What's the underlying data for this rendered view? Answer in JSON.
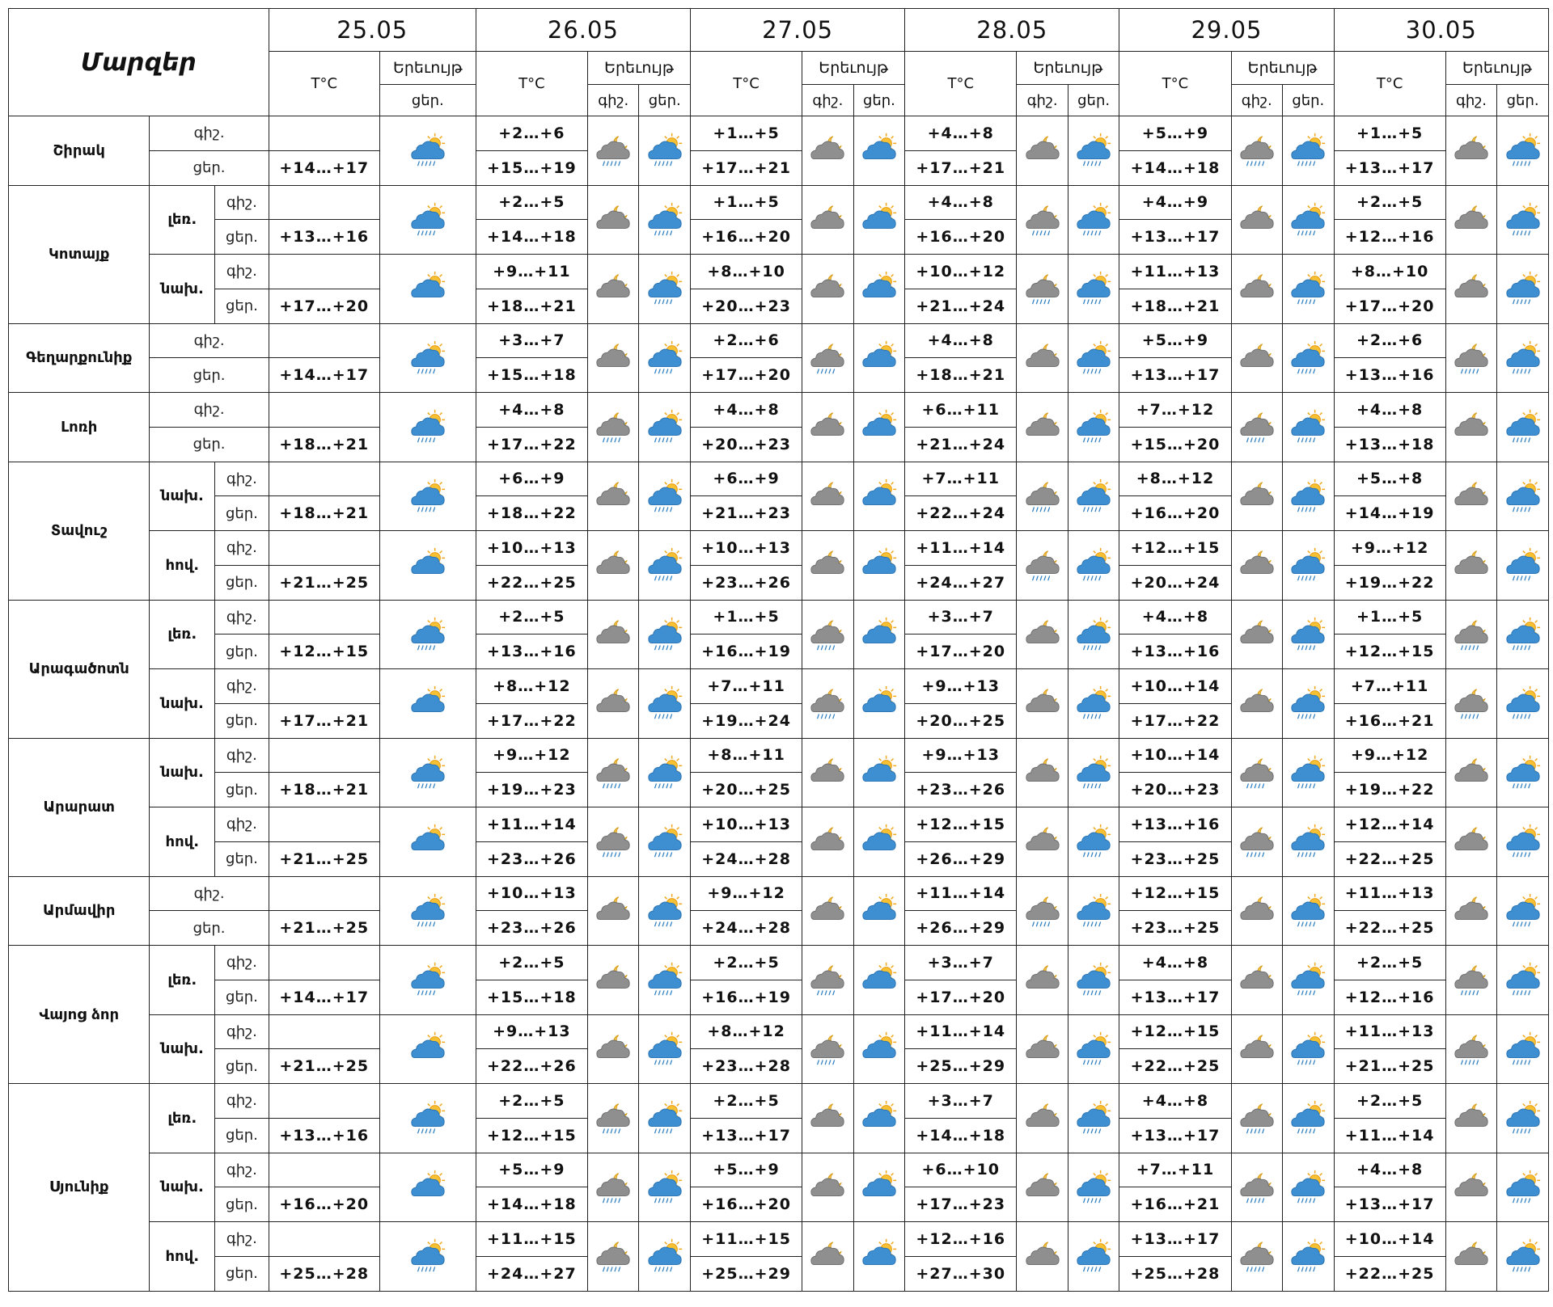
{
  "header": {
    "title": "Մարզեր",
    "dates": [
      "25.05",
      "26.05",
      "27.05",
      "28.05",
      "29.05",
      "30.05"
    ],
    "temp_label": "T°C",
    "weather_label": "Երեւույթ",
    "night": "գիշ.",
    "day": "ցեր."
  },
  "colors": {
    "border": "#222222",
    "sun": "#f5b82e",
    "cloud_blue": "#3d8fd1",
    "cloud_grey": "#8f8f8f",
    "rain": "#2d7fc2"
  },
  "regions": [
    {
      "name": "Շիրակ",
      "subs": [
        {
          "label": "",
          "d1_day": "+14…+17",
          "days": [
            {
              "n": "+2…+6",
              "d": "+15…+19"
            },
            {
              "n": "+1…+5",
              "d": "+17…+21"
            },
            {
              "n": "+4…+8",
              "d": "+17…+21"
            },
            {
              "n": "+5…+9",
              "d": "+14…+18"
            },
            {
              "n": "+1…+5",
              "d": "+13…+17"
            }
          ]
        }
      ]
    },
    {
      "name": "Կոտայք",
      "subs": [
        {
          "label": "լեռ.",
          "d1_day": "+13…+16",
          "days": [
            {
              "n": "+2…+5",
              "d": "+14…+18"
            },
            {
              "n": "+1…+5",
              "d": "+16…+20"
            },
            {
              "n": "+4…+8",
              "d": "+16…+20"
            },
            {
              "n": "+4…+9",
              "d": "+13…+17"
            },
            {
              "n": "+2…+5",
              "d": "+12…+16"
            }
          ]
        },
        {
          "label": "նախ.",
          "d1_day": "+17…+20",
          "days": [
            {
              "n": "+9…+11",
              "d": "+18…+21"
            },
            {
              "n": "+8…+10",
              "d": "+20…+23"
            },
            {
              "n": "+10…+12",
              "d": "+21…+24"
            },
            {
              "n": "+11…+13",
              "d": "+18…+21"
            },
            {
              "n": "+8…+10",
              "d": "+17…+20"
            }
          ]
        }
      ]
    },
    {
      "name": "Գեղարքունիք",
      "subs": [
        {
          "label": "",
          "d1_day": "+14…+17",
          "days": [
            {
              "n": "+3…+7",
              "d": "+15…+18"
            },
            {
              "n": "+2…+6",
              "d": "+17…+20"
            },
            {
              "n": "+4…+8",
              "d": "+18…+21"
            },
            {
              "n": "+5…+9",
              "d": "+13…+17"
            },
            {
              "n": "+2…+6",
              "d": "+13…+16"
            }
          ]
        }
      ]
    },
    {
      "name": "Լոռի",
      "subs": [
        {
          "label": "",
          "d1_day": "+18…+21",
          "days": [
            {
              "n": "+4…+8",
              "d": "+17…+22"
            },
            {
              "n": "+4…+8",
              "d": "+20…+23"
            },
            {
              "n": "+6…+11",
              "d": "+21…+24"
            },
            {
              "n": "+7…+12",
              "d": "+15…+20"
            },
            {
              "n": "+4…+8",
              "d": "+13…+18"
            }
          ]
        }
      ]
    },
    {
      "name": "Տավուշ",
      "subs": [
        {
          "label": "նախ.",
          "d1_day": "+18…+21",
          "days": [
            {
              "n": "+6…+9",
              "d": "+18…+22"
            },
            {
              "n": "+6…+9",
              "d": "+21…+23"
            },
            {
              "n": "+7…+11",
              "d": "+22…+24"
            },
            {
              "n": "+8…+12",
              "d": "+16…+20"
            },
            {
              "n": "+5…+8",
              "d": "+14…+19"
            }
          ]
        },
        {
          "label": "հով.",
          "d1_day": "+21…+25",
          "days": [
            {
              "n": "+10…+13",
              "d": "+22…+25"
            },
            {
              "n": "+10…+13",
              "d": "+23…+26"
            },
            {
              "n": "+11…+14",
              "d": "+24…+27"
            },
            {
              "n": "+12…+15",
              "d": "+20…+24"
            },
            {
              "n": "+9…+12",
              "d": "+19…+22"
            }
          ]
        }
      ]
    },
    {
      "name": "Արագածոտն",
      "subs": [
        {
          "label": "լեռ.",
          "d1_day": "+12…+15",
          "days": [
            {
              "n": "+2…+5",
              "d": "+13…+16"
            },
            {
              "n": "+1…+5",
              "d": "+16…+19"
            },
            {
              "n": "+3…+7",
              "d": "+17…+20"
            },
            {
              "n": "+4…+8",
              "d": "+13…+16"
            },
            {
              "n": "+1…+5",
              "d": "+12…+15"
            }
          ]
        },
        {
          "label": "նախ.",
          "d1_day": "+17…+21",
          "days": [
            {
              "n": "+8…+12",
              "d": "+17…+22"
            },
            {
              "n": "+7…+11",
              "d": "+19…+24"
            },
            {
              "n": "+9…+13",
              "d": "+20…+25"
            },
            {
              "n": "+10…+14",
              "d": "+17…+22"
            },
            {
              "n": "+7…+11",
              "d": "+16…+21"
            }
          ]
        }
      ]
    },
    {
      "name": "Արարատ",
      "subs": [
        {
          "label": "նախ.",
          "d1_day": "+18…+21",
          "days": [
            {
              "n": "+9…+12",
              "d": "+19…+23"
            },
            {
              "n": "+8…+11",
              "d": "+20…+25"
            },
            {
              "n": "+9…+13",
              "d": "+23…+26"
            },
            {
              "n": "+10…+14",
              "d": "+20…+23"
            },
            {
              "n": "+9…+12",
              "d": "+19…+22"
            }
          ]
        },
        {
          "label": "հով.",
          "d1_day": "+21…+25",
          "days": [
            {
              "n": "+11…+14",
              "d": "+23…+26"
            },
            {
              "n": "+10…+13",
              "d": "+24…+28"
            },
            {
              "n": "+12…+15",
              "d": "+26…+29"
            },
            {
              "n": "+13…+16",
              "d": "+23…+25"
            },
            {
              "n": "+12…+14",
              "d": "+22…+25"
            }
          ]
        }
      ]
    },
    {
      "name": "Արմավիր",
      "subs": [
        {
          "label": "",
          "d1_day": "+21…+25",
          "days": [
            {
              "n": "+10…+13",
              "d": "+23…+26"
            },
            {
              "n": "+9…+12",
              "d": "+24…+28"
            },
            {
              "n": "+11…+14",
              "d": "+26…+29"
            },
            {
              "n": "+12…+15",
              "d": "+23…+25"
            },
            {
              "n": "+11…+13",
              "d": "+22…+25"
            }
          ]
        }
      ]
    },
    {
      "name": "Վայոց ձոր",
      "subs": [
        {
          "label": "լեռ.",
          "d1_day": "+14…+17",
          "days": [
            {
              "n": "+2…+5",
              "d": "+15…+18"
            },
            {
              "n": "+2…+5",
              "d": "+16…+19"
            },
            {
              "n": "+3…+7",
              "d": "+17…+20"
            },
            {
              "n": "+4…+8",
              "d": "+13…+17"
            },
            {
              "n": "+2…+5",
              "d": "+12…+16"
            }
          ]
        },
        {
          "label": "նախ.",
          "d1_day": "+21…+25",
          "days": [
            {
              "n": "+9…+13",
              "d": "+22…+26"
            },
            {
              "n": "+8…+12",
              "d": "+23…+28"
            },
            {
              "n": "+11…+14",
              "d": "+25…+29"
            },
            {
              "n": "+12…+15",
              "d": "+22…+25"
            },
            {
              "n": "+11…+13",
              "d": "+21…+25"
            }
          ]
        }
      ]
    },
    {
      "name": "Սյունիք",
      "subs": [
        {
          "label": "լեռ.",
          "d1_day": "+13…+16",
          "days": [
            {
              "n": "+2…+5",
              "d": "+12…+15"
            },
            {
              "n": "+2…+5",
              "d": "+13…+17"
            },
            {
              "n": "+3…+7",
              "d": "+14…+18"
            },
            {
              "n": "+4…+8",
              "d": "+13…+17"
            },
            {
              "n": "+2…+5",
              "d": "+11…+14"
            }
          ]
        },
        {
          "label": "նախ.",
          "d1_day": "+16…+20",
          "days": [
            {
              "n": "+5…+9",
              "d": "+14…+18"
            },
            {
              "n": "+5…+9",
              "d": "+16…+20"
            },
            {
              "n": "+6…+10",
              "d": "+17…+23"
            },
            {
              "n": "+7…+11",
              "d": "+16…+21"
            },
            {
              "n": "+4…+8",
              "d": "+13…+17"
            }
          ]
        },
        {
          "label": "հով.",
          "d1_day": "+25…+28",
          "days": [
            {
              "n": "+11…+15",
              "d": "+24…+27"
            },
            {
              "n": "+11…+15",
              "d": "+25…+29"
            },
            {
              "n": "+12…+16",
              "d": "+27…+30"
            },
            {
              "n": "+13…+17",
              "d": "+25…+28"
            },
            {
              "n": "+10…+14",
              "d": "+22…+25"
            }
          ]
        }
      ]
    }
  ]
}
